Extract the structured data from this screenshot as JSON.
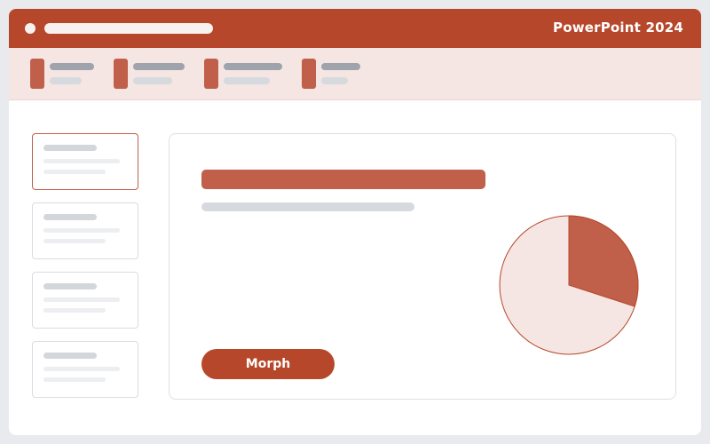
{
  "app": {
    "title": "PowerPoint 2024"
  },
  "colors": {
    "accent": "#b7472a",
    "accent_light": "#c0604a",
    "ribbon_bg": "#f5e6e3",
    "pie_bg": "#f5e6e3"
  },
  "slide": {
    "button_label": "Morph",
    "pie": {
      "highlighted_fraction": 0.3
    }
  }
}
